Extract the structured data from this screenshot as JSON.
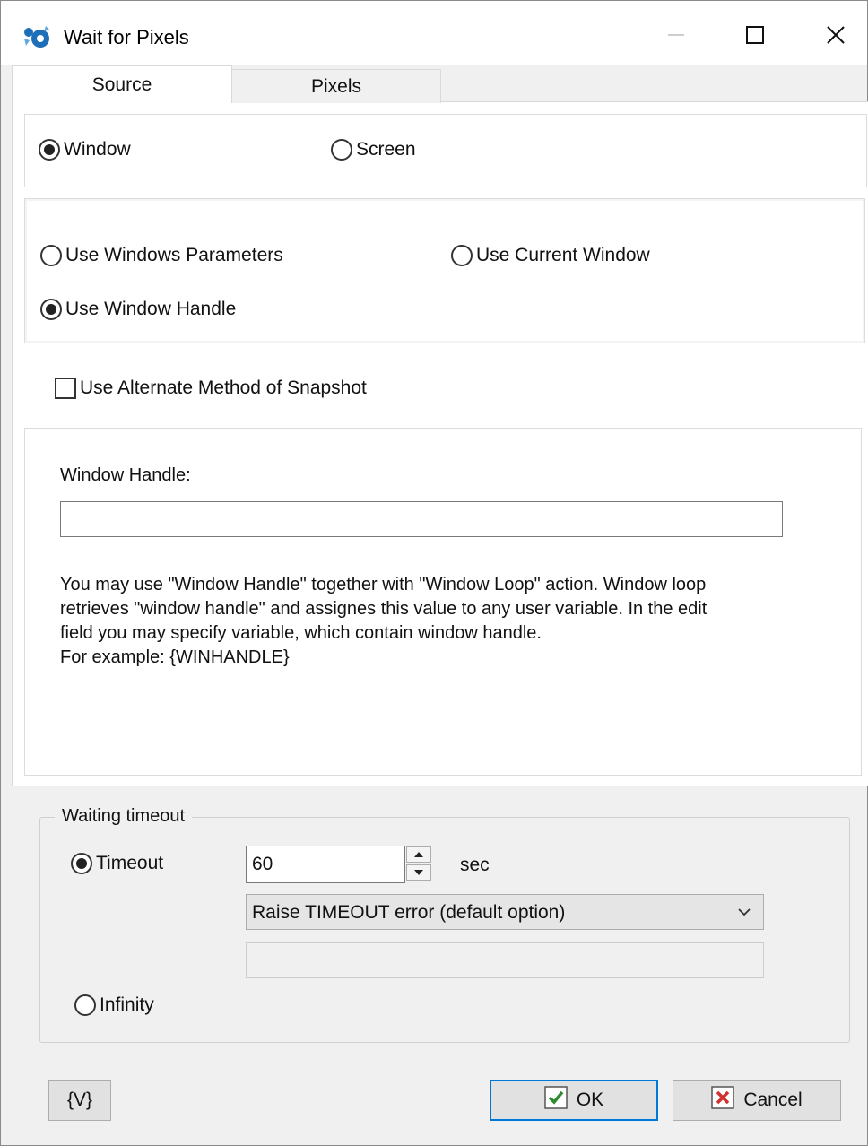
{
  "window": {
    "title": "Wait for Pixels",
    "controls": {
      "minimize": "minimize-icon",
      "maximize": "maximize-icon",
      "close": "close-icon"
    }
  },
  "tabs": [
    {
      "label": "Source",
      "selected": true
    },
    {
      "label": "Pixels",
      "selected": false
    }
  ],
  "source_type": {
    "window_label": "Window",
    "screen_label": "Screen",
    "selected": "Window"
  },
  "window_mode": {
    "use_windows_parameters": "Use Windows Parameters",
    "use_current_window": "Use Current Window",
    "use_window_handle": "Use Window Handle",
    "selected": "Use Window Handle"
  },
  "alternate_snapshot": {
    "label": "Use Alternate Method of Snapshot",
    "checked": false
  },
  "window_handle": {
    "label": "Window Handle:",
    "value": "",
    "help": "You may use \"Window Handle\" together with \"Window Loop\" action. Window loop\nretrieves \"window handle\" and assignes this value to any user variable. In the edit\nfield you may specify variable, which contain window handle.\nFor example: {WINHANDLE}"
  },
  "waiting_timeout": {
    "caption": "Waiting timeout",
    "timeout_label": "Timeout",
    "timeout_value": "60",
    "unit": "sec",
    "action_selected": "Raise TIMEOUT error (default option)",
    "extra_value": "",
    "infinity_label": "Infinity",
    "selected": "Timeout"
  },
  "buttons": {
    "variables": "{V}",
    "ok": "OK",
    "cancel": "Cancel"
  },
  "colors": {
    "accent": "#0078d7",
    "ok_check": "#2e8b2e",
    "cancel_x": "#d32f2f",
    "app_icon": "#1e6fb8"
  }
}
